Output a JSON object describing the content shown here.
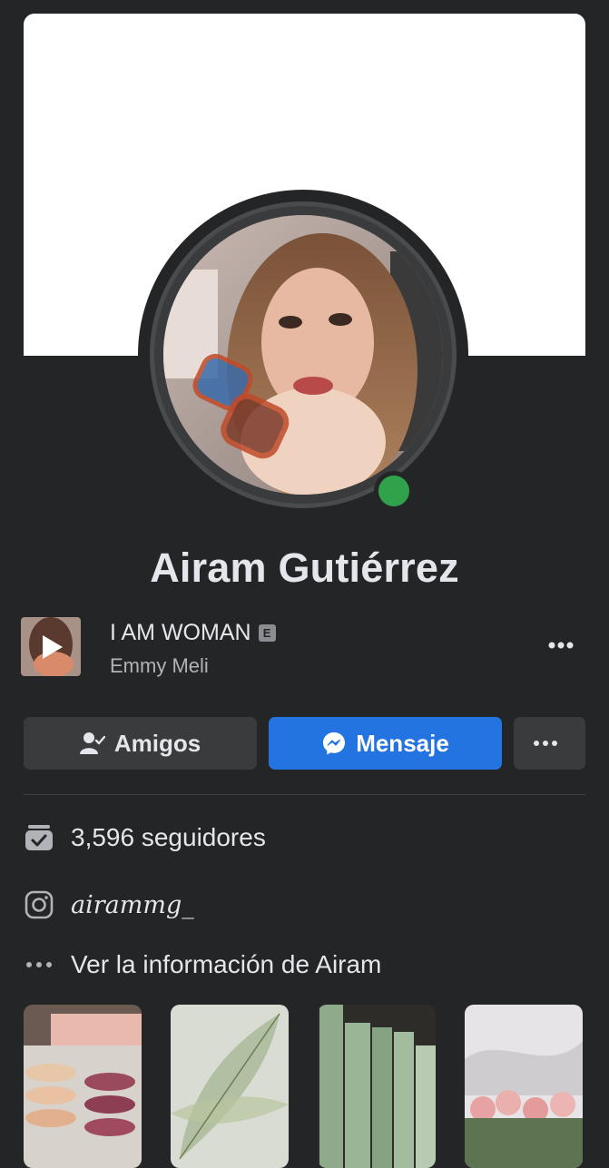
{
  "profile": {
    "name": "Airam Gutiérrez",
    "online": true
  },
  "music": {
    "title": "I AM WOMAN",
    "explicit_badge": "E",
    "artist": "Emmy Meli"
  },
  "actions": {
    "friends_label": "Amigos",
    "message_label": "Mensaje"
  },
  "intro": {
    "followers": "3,596 seguidores",
    "instagram": "airammg_",
    "see_info": "Ver la información de Airam"
  },
  "colors": {
    "background": "#242526",
    "primary_button": "#2374e1",
    "online": "#31a24c"
  },
  "icons": {
    "friends": "person-check-icon",
    "message": "messenger-icon",
    "followers": "rss-check-icon",
    "instagram": "instagram-icon",
    "more": "more-horizontal-icon"
  }
}
